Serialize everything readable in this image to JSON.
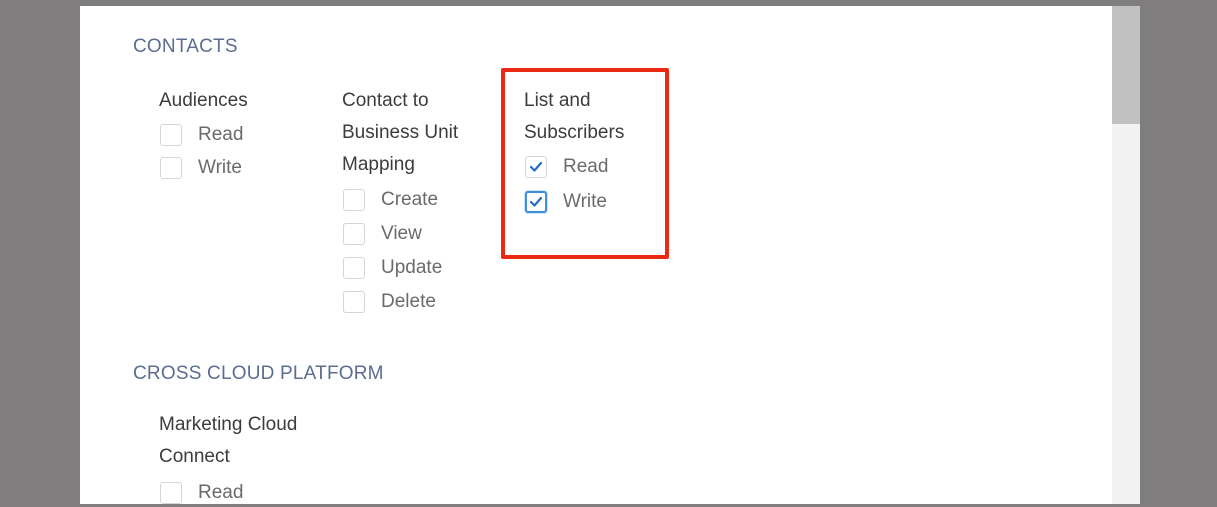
{
  "sections": {
    "contacts": {
      "title": "CONTACTS",
      "audiences": {
        "title": "Audiences",
        "options": [
          {
            "label": "Read",
            "checked": false
          },
          {
            "label": "Write",
            "checked": false
          }
        ]
      },
      "contact_bu": {
        "title_lines": [
          "Contact to",
          "Business Unit",
          "Mapping"
        ],
        "options": [
          {
            "label": "Create",
            "checked": false
          },
          {
            "label": "View",
            "checked": false
          },
          {
            "label": "Update",
            "checked": false
          },
          {
            "label": "Delete",
            "checked": false
          }
        ]
      },
      "lists": {
        "title_lines": [
          "List and",
          "Subscribers"
        ],
        "options": [
          {
            "label": "Read",
            "checked": true
          },
          {
            "label": "Write",
            "checked": true
          }
        ]
      }
    },
    "cross_cloud": {
      "title": "CROSS CLOUD PLATFORM",
      "mc_connect": {
        "title_lines": [
          "Marketing Cloud",
          "Connect"
        ],
        "options": [
          {
            "label": "Read",
            "checked": false
          }
        ]
      }
    }
  },
  "colors": {
    "section_title": "#5c6c92",
    "highlight_border": "#ea2a12",
    "checkmark": "#1f6fc1",
    "focus_ring": "#3f8fd8"
  }
}
